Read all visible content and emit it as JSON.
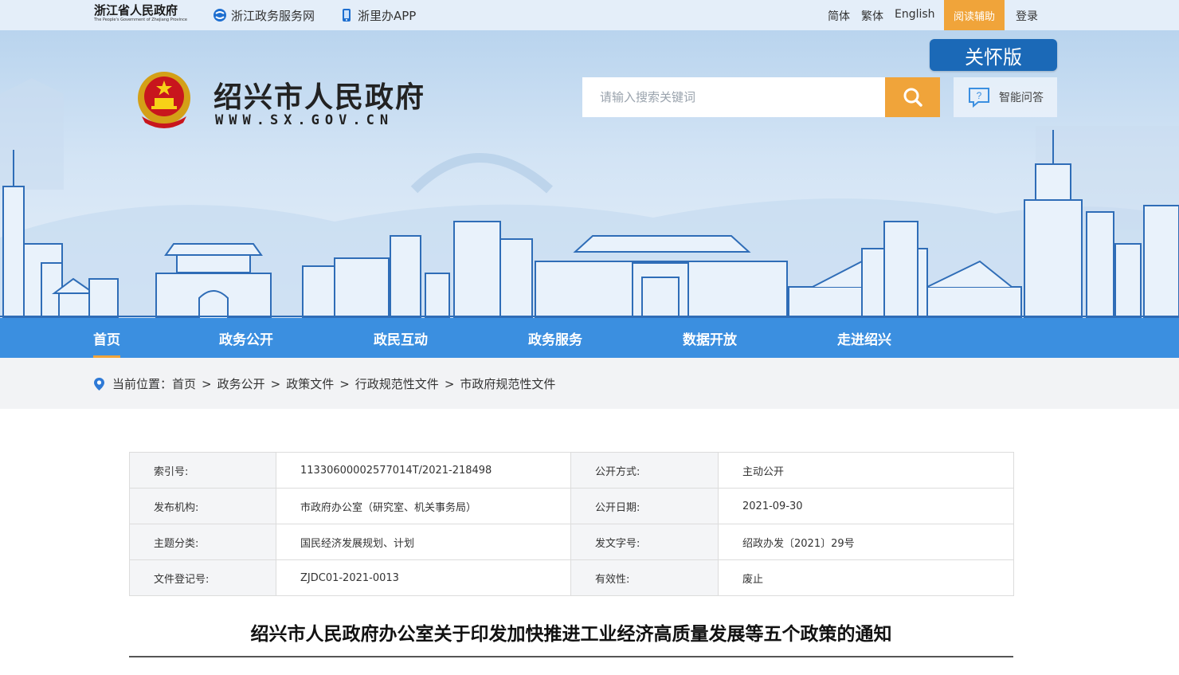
{
  "topbar": {
    "province_logo_cn": "浙江省人民政府",
    "province_logo_en": "The People's Government of Zhejiang Province",
    "links": [
      {
        "label": "浙江政务服务网",
        "icon": "service-net-icon"
      },
      {
        "label": "浙里办APP",
        "icon": "mobile-app-icon"
      }
    ],
    "lang": {
      "simplified": "简体",
      "traditional": "繁体",
      "english": "English"
    },
    "assist_label": "阅读辅助",
    "login_label": "登录",
    "accent_color": "#f0a43a"
  },
  "header": {
    "site_title": "绍兴市人民政府",
    "site_url": "WWW.SX.GOV.CN",
    "care_label": "关怀版",
    "search": {
      "placeholder": "请输入搜索关键词",
      "value": ""
    },
    "qa_label": "智能问答",
    "brand_color": "#1b69b7"
  },
  "nav": {
    "items": [
      {
        "label": "首页",
        "active": true
      },
      {
        "label": "政务公开"
      },
      {
        "label": "政民互动"
      },
      {
        "label": "政务服务"
      },
      {
        "label": "数据开放"
      },
      {
        "label": "走进绍兴"
      }
    ],
    "bg_color": "#3b8fe0"
  },
  "breadcrumb": {
    "prefix": "当前位置：",
    "items": [
      "首页",
      "政务公开",
      "政策文件",
      "行政规范性文件",
      "市政府规范性文件"
    ],
    "separator": ">"
  },
  "info_table": {
    "rows": [
      {
        "label1": "索引号:",
        "value1": "11330600002577014T/2021-218498",
        "label2": "公开方式:",
        "value2": "主动公开"
      },
      {
        "label1": "发布机构:",
        "value1": "市政府办公室（研究室、机关事务局）",
        "label2": "公开日期:",
        "value2": "2021-09-30"
      },
      {
        "label1": "主题分类:",
        "value1": "国民经济发展规划、计划",
        "label2": "发文字号:",
        "value2": "绍政办发〔2021〕29号"
      },
      {
        "label1": "文件登记号:",
        "value1": "ZJDC01-2021-0013",
        "label2": "有效性:",
        "value2": "废止"
      }
    ]
  },
  "document": {
    "title": "绍兴市人民政府办公室关于印发加快推进工业经济高质量发展等五个政策的通知"
  }
}
